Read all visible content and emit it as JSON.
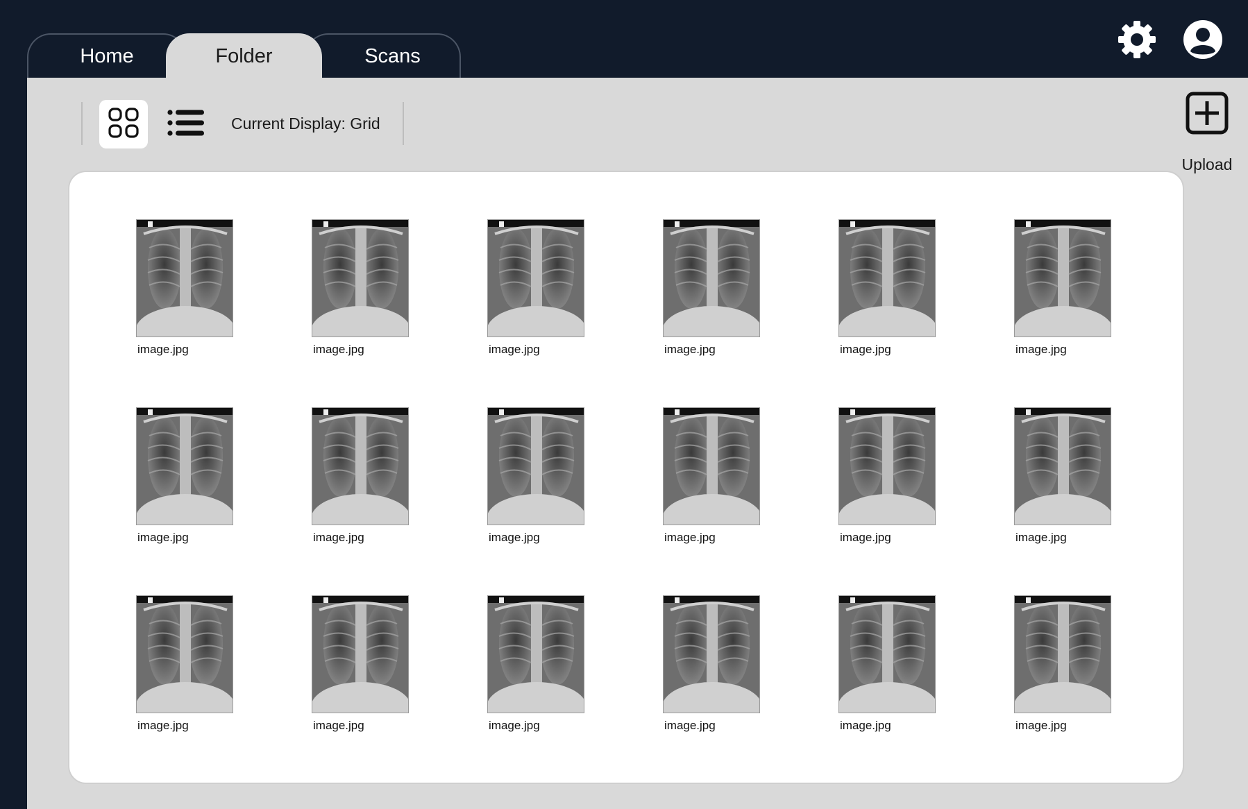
{
  "tabs": [
    {
      "label": "Home"
    },
    {
      "label": "Folder"
    },
    {
      "label": "Scans"
    }
  ],
  "active_tab": "Folder",
  "header_icons": [
    "gear-icon",
    "user-avatar-icon"
  ],
  "toolbar": {
    "grid_view_icon": "grid-view-icon",
    "list_view_icon": "list-view-icon",
    "display_label": "Current Display: Grid",
    "upload_label": "Upload",
    "upload_icon": "plus-square-icon"
  },
  "files": [
    {
      "name": "image.jpg"
    },
    {
      "name": "image.jpg"
    },
    {
      "name": "image.jpg"
    },
    {
      "name": "image.jpg"
    },
    {
      "name": "image.jpg"
    },
    {
      "name": "image.jpg"
    },
    {
      "name": "image.jpg"
    },
    {
      "name": "image.jpg"
    },
    {
      "name": "image.jpg"
    },
    {
      "name": "image.jpg"
    },
    {
      "name": "image.jpg"
    },
    {
      "name": "image.jpg"
    },
    {
      "name": "image.jpg"
    },
    {
      "name": "image.jpg"
    },
    {
      "name": "image.jpg"
    },
    {
      "name": "image.jpg"
    },
    {
      "name": "image.jpg"
    },
    {
      "name": "image.jpg"
    }
  ],
  "colors": {
    "header_bg": "#111b2b",
    "panel_bg": "#d9d9d9",
    "card_bg": "#ffffff"
  }
}
